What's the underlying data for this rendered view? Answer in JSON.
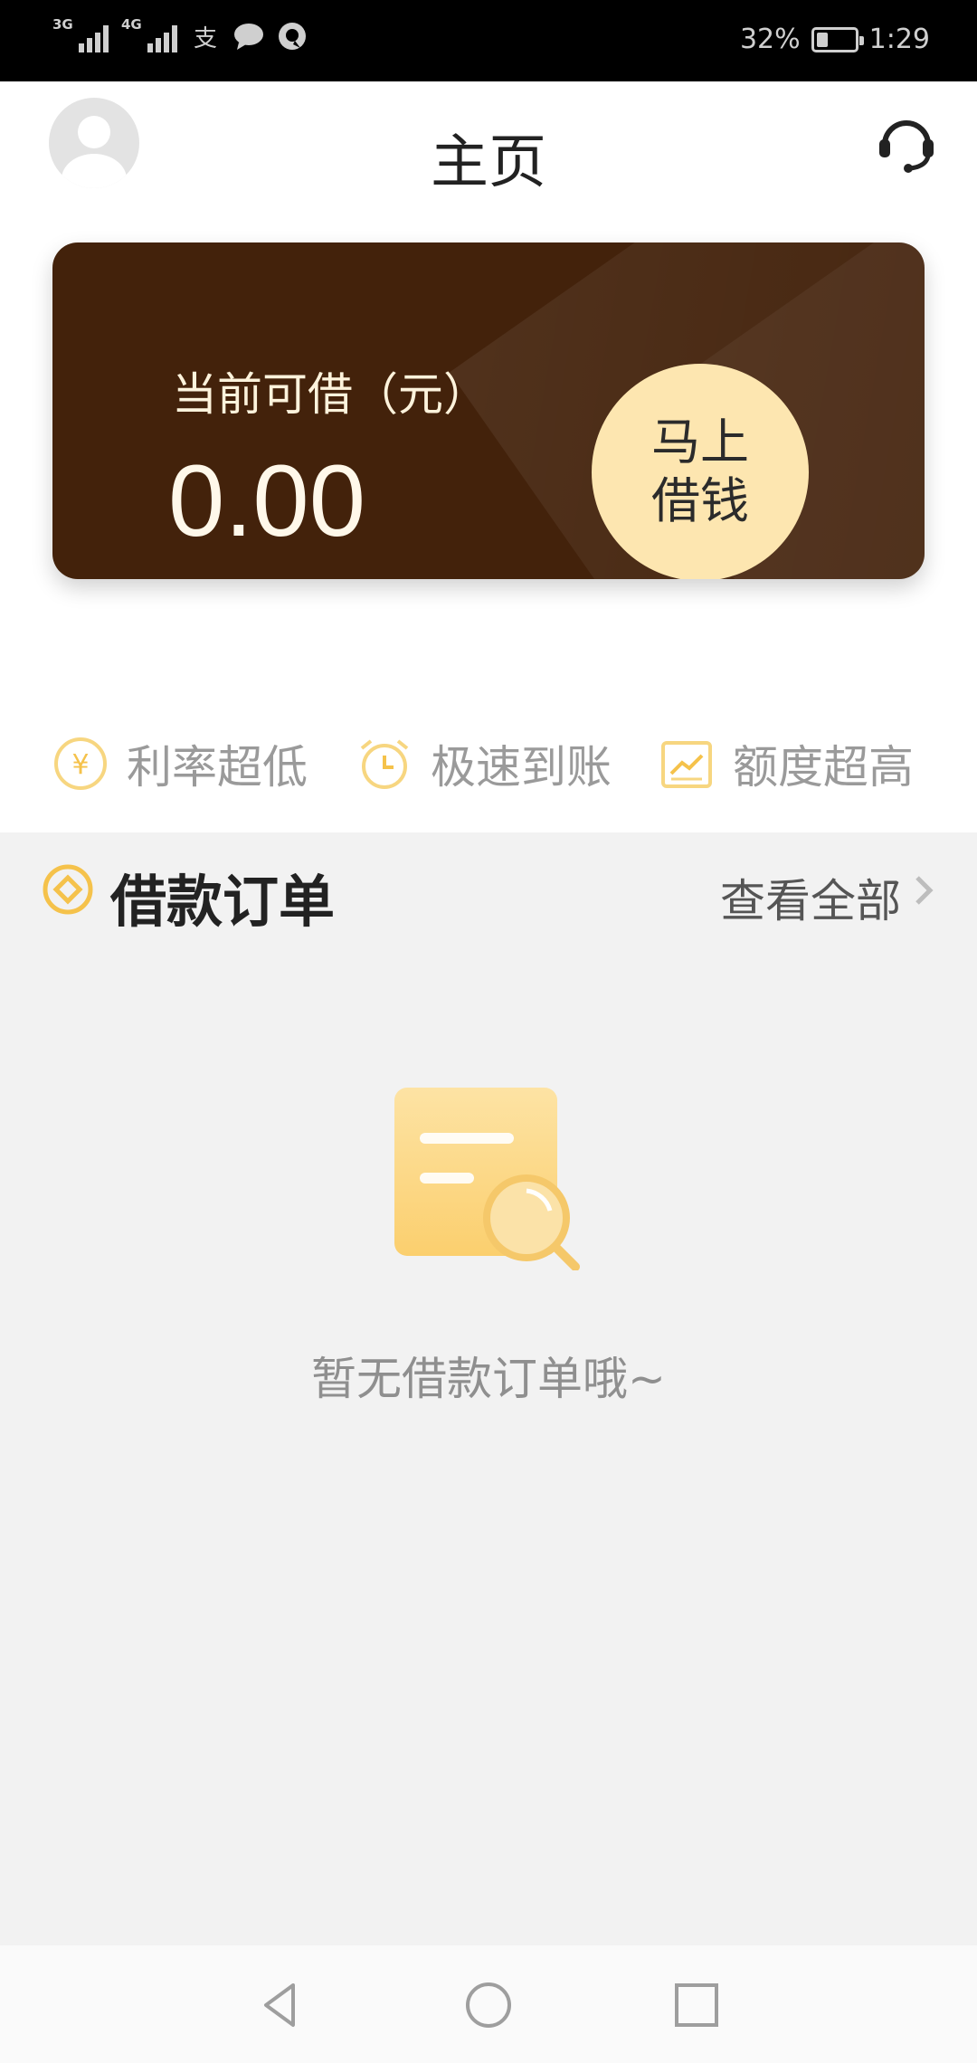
{
  "status_bar": {
    "network_1": "3G",
    "network_2": "4G",
    "battery_text": "32%",
    "battery_level": 0.32,
    "time": "1:29",
    "icons": [
      "alipay-icon",
      "chat-icon",
      "qq-icon"
    ]
  },
  "header": {
    "title": "主页",
    "avatar": "avatar-icon",
    "support_icon": "headset-icon"
  },
  "card": {
    "label": "当前可借（元）",
    "amount": "0.00",
    "button_line1": "马上",
    "button_line2": "借钱"
  },
  "features": [
    {
      "icon": "yuan-icon",
      "label": "利率超低"
    },
    {
      "icon": "alarm-clock-icon",
      "label": "极速到账"
    },
    {
      "icon": "chart-icon",
      "label": "额度超高"
    }
  ],
  "orders": {
    "title": "借款订单",
    "view_all": "查看全部",
    "empty_text": "暂无借款订单哦~"
  },
  "colors": {
    "accent": "#f5c24b",
    "card_bg": "#43220b",
    "button_bg": "#fde6b0"
  }
}
